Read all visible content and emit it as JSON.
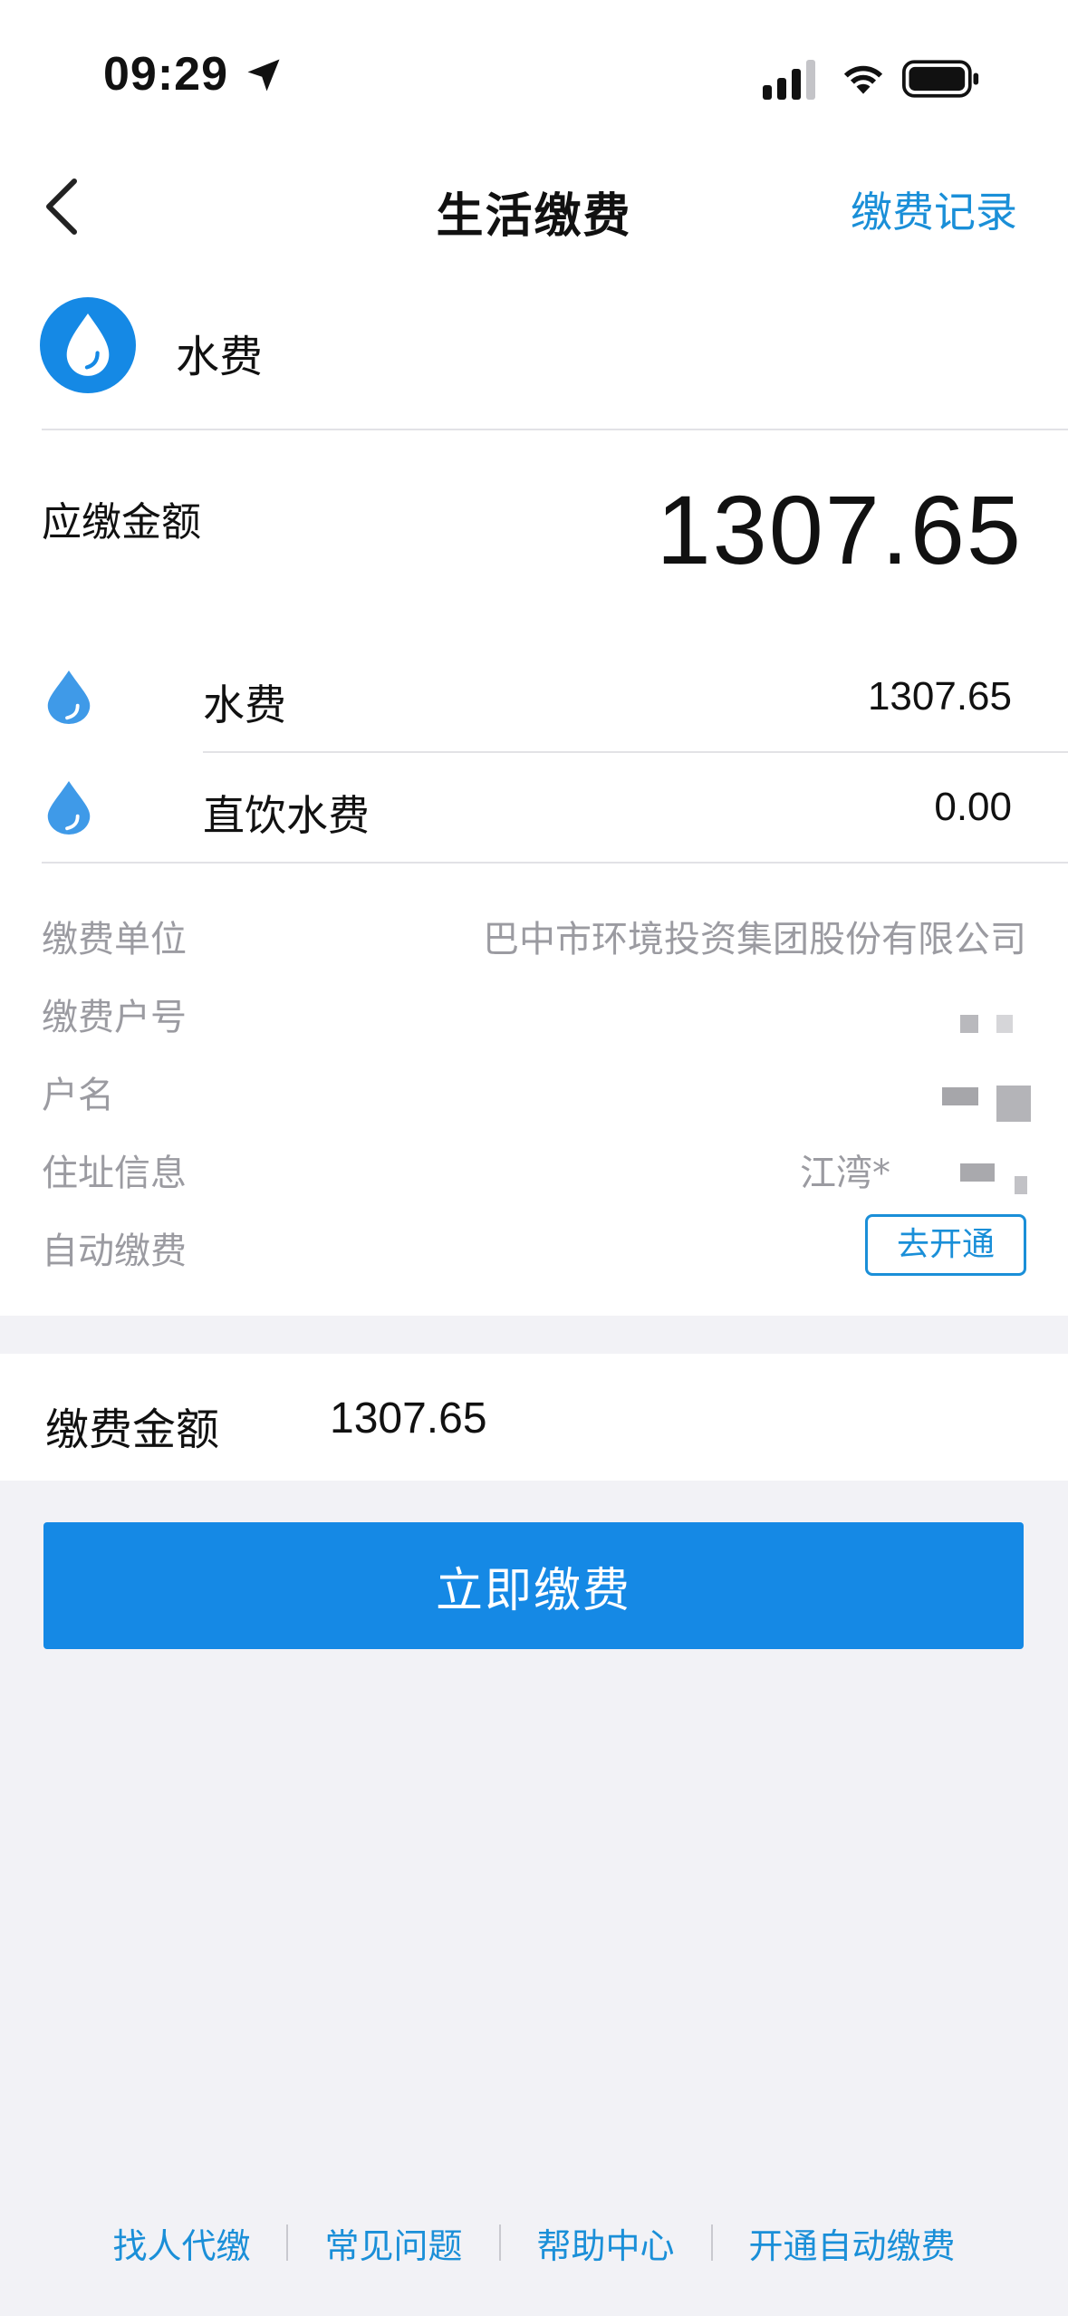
{
  "status_bar": {
    "time": "09:29"
  },
  "nav": {
    "title": "生活缴费",
    "action": "缴费记录"
  },
  "service": {
    "name": "水费",
    "accent_color": "#1589e5",
    "icon": "water-drop-icon"
  },
  "amount_due": {
    "label": "应缴金额",
    "value": "1307.65"
  },
  "items": [
    {
      "name": "水费",
      "value": "1307.65"
    },
    {
      "name": "直饮水费",
      "value": "0.00"
    }
  ],
  "info": {
    "unit_label": "缴费单位",
    "unit_value": "巴中市环境投资集团股份有限公司",
    "account_label": "缴费户号",
    "name_label": "户名",
    "address_label": "住址信息",
    "address_value": "江湾*",
    "auto_label": "自动缴费",
    "auto_button": "去开通"
  },
  "payment": {
    "label": "缴费金额",
    "value": "1307.65",
    "button": "立即缴费"
  },
  "footer": {
    "links": [
      "找人代缴",
      "常见问题",
      "帮助中心",
      "开通自动缴费"
    ]
  }
}
